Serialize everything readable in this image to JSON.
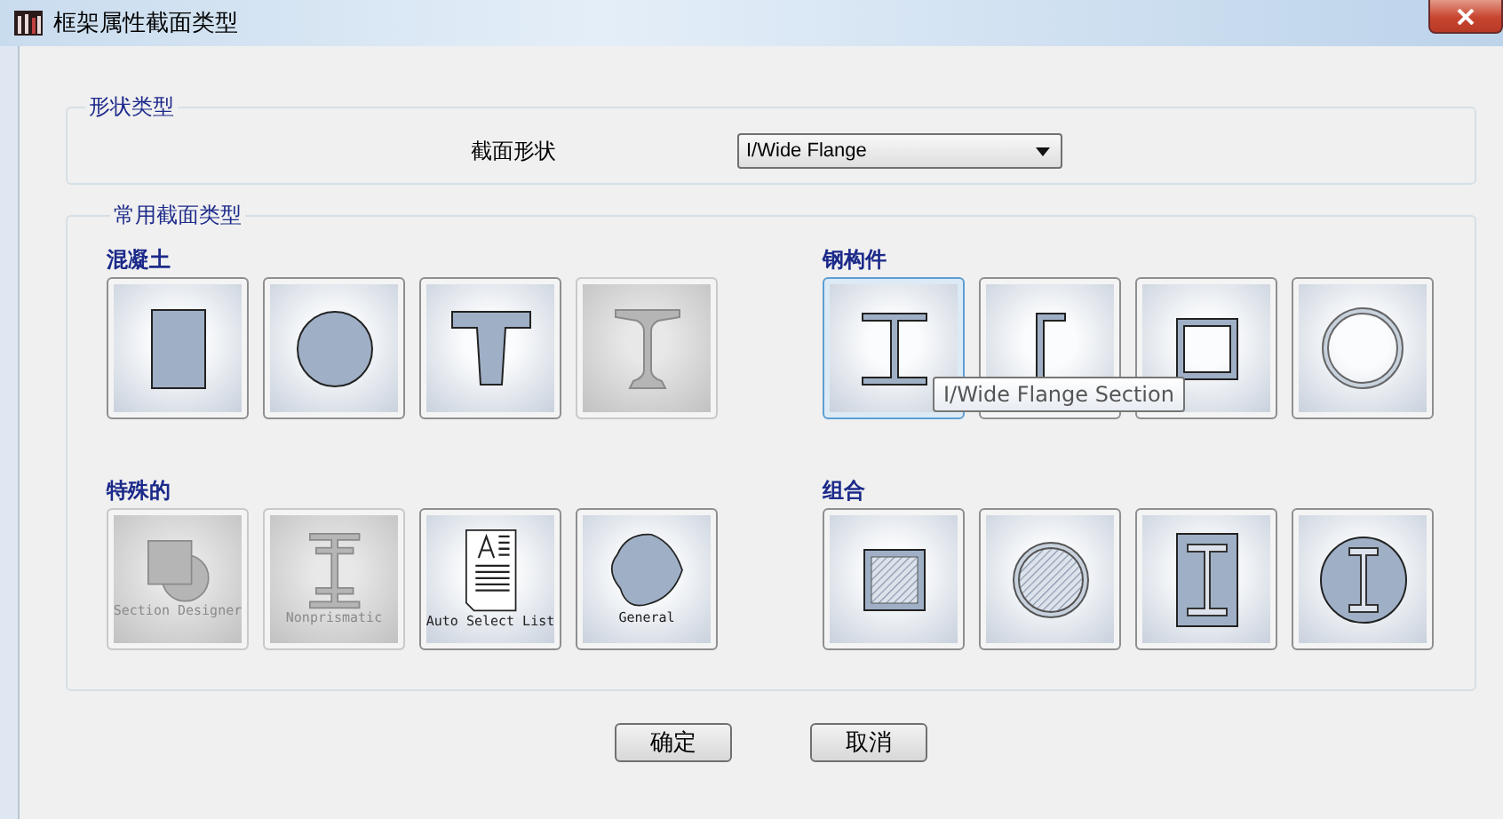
{
  "window": {
    "title": "框架属性截面类型"
  },
  "shape_type": {
    "title": "形状类型",
    "label": "截面形状",
    "value": "I/Wide Flange"
  },
  "common": {
    "title": "常用截面类型",
    "categories": [
      {
        "title": "混凝土",
        "tiles": [
          {
            "kind": "rect",
            "disabled": false,
            "selected": false
          },
          {
            "kind": "circle",
            "disabled": false,
            "selected": false
          },
          {
            "kind": "tee",
            "disabled": false,
            "selected": false
          },
          {
            "kind": "precast-i",
            "disabled": true,
            "selected": false
          }
        ]
      },
      {
        "title": "钢构件",
        "tiles": [
          {
            "kind": "i-beam",
            "disabled": false,
            "selected": true
          },
          {
            "kind": "channel",
            "disabled": false,
            "selected": false
          },
          {
            "kind": "box",
            "disabled": false,
            "selected": false
          },
          {
            "kind": "pipe",
            "disabled": false,
            "selected": false
          }
        ]
      },
      {
        "title": "特殊的",
        "tiles": [
          {
            "kind": "section-designer",
            "disabled": true,
            "selected": false,
            "caption": "Section Designer"
          },
          {
            "kind": "nonprismatic",
            "disabled": true,
            "selected": false,
            "caption": "Nonprismatic"
          },
          {
            "kind": "auto-select",
            "disabled": false,
            "selected": false,
            "caption": "Auto Select List"
          },
          {
            "kind": "general",
            "disabled": false,
            "selected": false,
            "caption": "General"
          }
        ]
      },
      {
        "title": "组合",
        "tiles": [
          {
            "kind": "filled-box",
            "disabled": false,
            "selected": false
          },
          {
            "kind": "filled-pipe",
            "disabled": false,
            "selected": false
          },
          {
            "kind": "encased-i",
            "disabled": false,
            "selected": false
          },
          {
            "kind": "encased-i-circle",
            "disabled": false,
            "selected": false
          }
        ]
      }
    ]
  },
  "tooltip": {
    "text": "I/Wide Flange Section"
  },
  "buttons": [
    "确定",
    "取消"
  ]
}
